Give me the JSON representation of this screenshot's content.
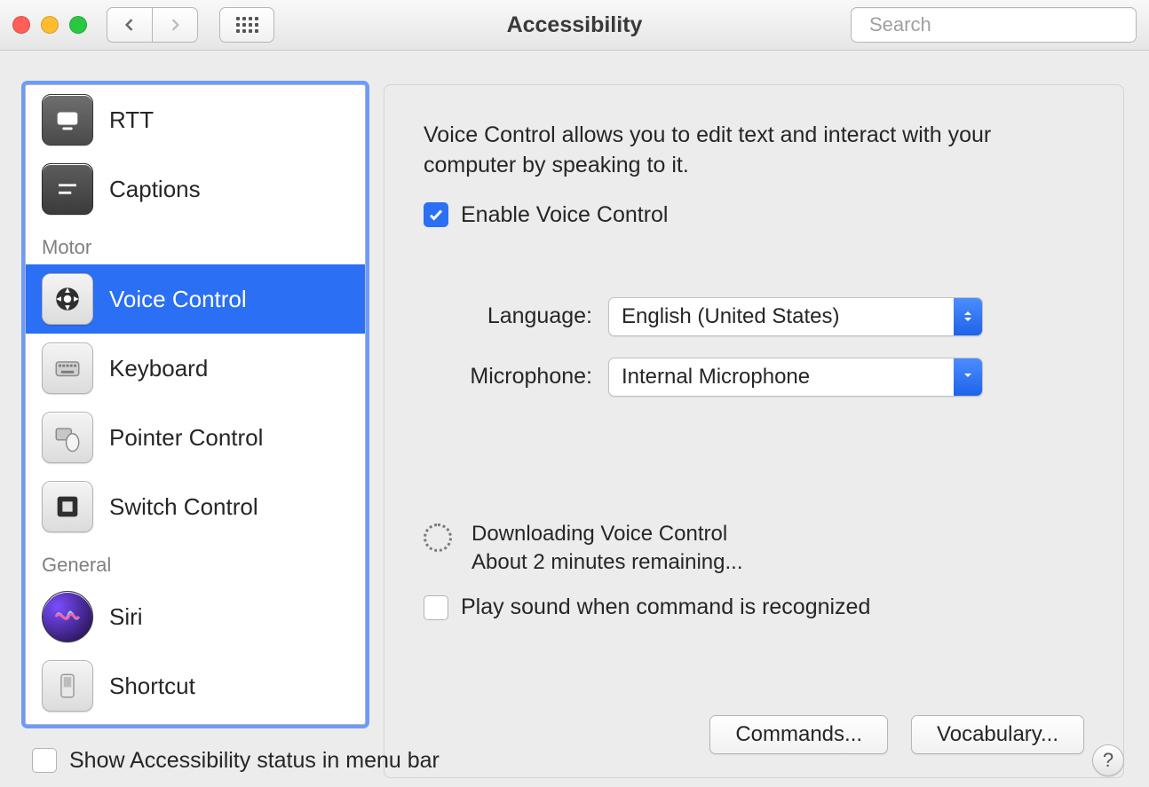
{
  "window": {
    "title": "Accessibility",
    "search_placeholder": "Search"
  },
  "sidebar": {
    "headers": {
      "motor": "Motor",
      "general": "General"
    },
    "items": {
      "rtt": "RTT",
      "captions": "Captions",
      "voice_control": "Voice Control",
      "keyboard": "Keyboard",
      "pointer_control": "Pointer Control",
      "switch_control": "Switch Control",
      "siri": "Siri",
      "shortcut": "Shortcut"
    }
  },
  "detail": {
    "description": "Voice Control allows you to edit text and interact with your computer by speaking to it.",
    "enable_label": "Enable Voice Control",
    "enable_checked": true,
    "language_label": "Language:",
    "language_value": "English (United States)",
    "microphone_label": "Microphone:",
    "microphone_value": "Internal Microphone",
    "download_title": "Downloading Voice Control",
    "download_status": "About 2 minutes remaining...",
    "play_sound_label": "Play sound when command is recognized",
    "play_sound_checked": false,
    "commands_button": "Commands...",
    "vocabulary_button": "Vocabulary..."
  },
  "footer": {
    "show_status_label": "Show Accessibility status in menu bar",
    "show_status_checked": false,
    "help_label": "?"
  }
}
